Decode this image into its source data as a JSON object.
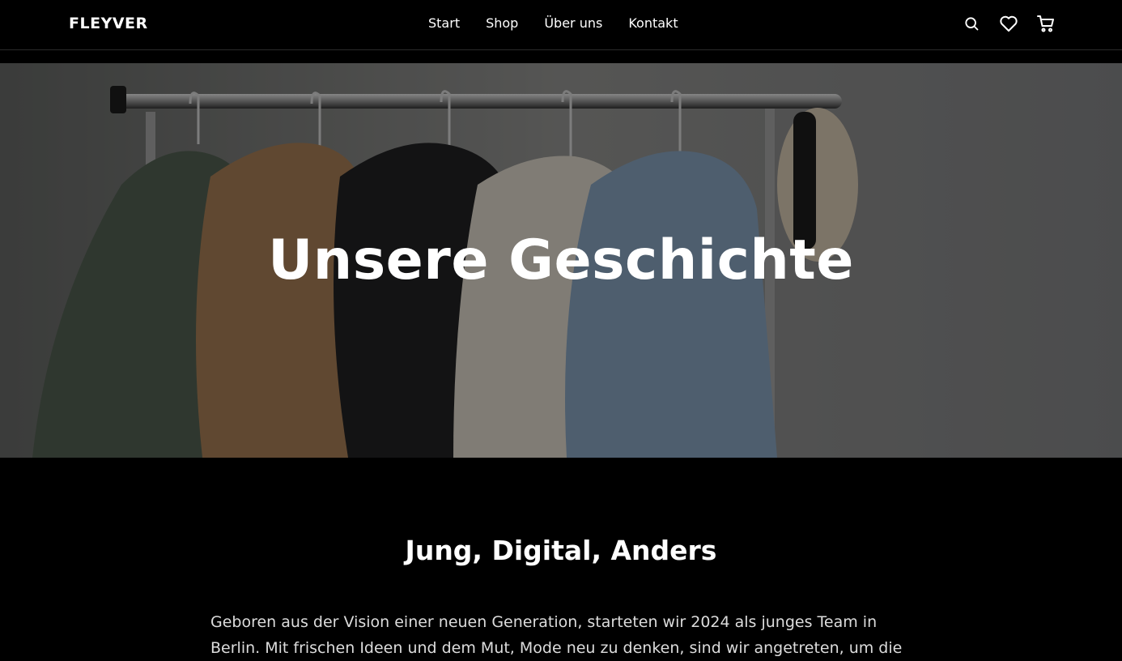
{
  "brand": {
    "logo_text": "FLEYVER"
  },
  "nav": {
    "items": [
      {
        "label": "Start"
      },
      {
        "label": "Shop"
      },
      {
        "label": "Über uns"
      },
      {
        "label": "Kontakt"
      }
    ]
  },
  "header_icons": [
    "search-icon",
    "heart-icon",
    "cart-icon"
  ],
  "hero": {
    "title": "Unsere Geschichte"
  },
  "about": {
    "heading": "Jung, Digital, Anders",
    "text": "Geboren aus der Vision einer neuen Generation, starteten wir 2024 als junges Team in Berlin. Mit frischen Ideen und dem Mut, Mode neu zu denken, sind wir angetreten, um die"
  },
  "colors": {
    "background": "#000000",
    "text": "#ffffff",
    "body_text": "#dcdcdc"
  }
}
